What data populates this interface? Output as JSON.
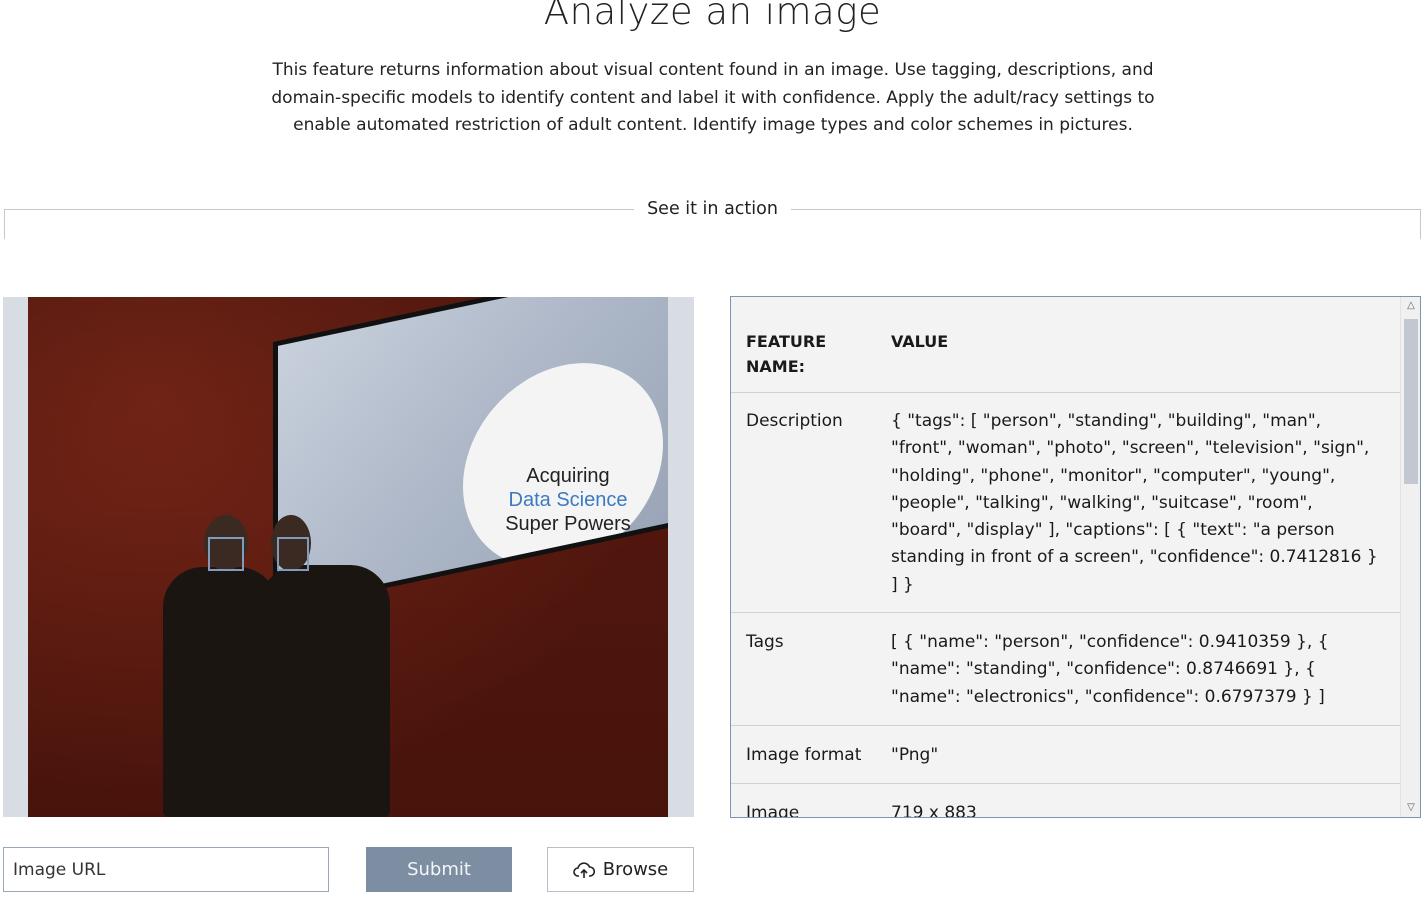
{
  "header": {
    "title": "Analyze an image",
    "intro": "This feature returns information about visual content found in an image. Use tagging, descriptions, and domain-specific models to identify content and label it with confidence. Apply the adult/racy settings to enable automated restriction of adult content. Identify image types and color schemes in pictures."
  },
  "section": {
    "label": "See it in action"
  },
  "image": {
    "slide_line1": "Acquiring",
    "slide_line2": "Data Science",
    "slide_line3": "Super Powers"
  },
  "results": {
    "columns": {
      "name": "FEATURE NAME:",
      "value": "VALUE"
    },
    "rows": [
      {
        "name": "Description",
        "value": "{ \"tags\": [ \"person\", \"standing\", \"building\", \"man\", \"front\", \"woman\", \"photo\", \"screen\", \"television\", \"sign\", \"holding\", \"phone\", \"monitor\", \"computer\", \"young\", \"people\", \"talking\", \"walking\", \"suitcase\", \"room\", \"board\", \"display\" ], \"captions\": [ { \"text\": \"a person standing in front of a screen\", \"confidence\": 0.7412816 } ] }"
      },
      {
        "name": "Tags",
        "value": "[ { \"name\": \"person\", \"confidence\": 0.9410359 }, { \"name\": \"standing\", \"confidence\": 0.8746691 }, { \"name\": \"electronics\", \"confidence\": 0.6797379 } ]"
      },
      {
        "name": "Image format",
        "value": "\"Png\""
      },
      {
        "name": "Image dimensions",
        "value": "719 x 883"
      }
    ]
  },
  "controls": {
    "url_placeholder": "Image URL",
    "submit_label": "Submit",
    "browse_label": "Browse"
  },
  "colors": {
    "submit_bg": "#7d8ea2",
    "table_border": "#7d95b5"
  }
}
